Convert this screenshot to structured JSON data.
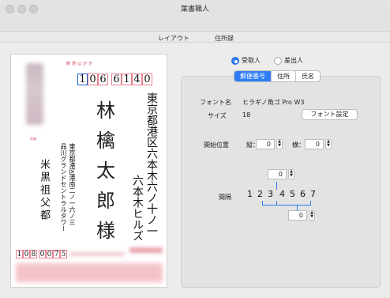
{
  "window": {
    "title": "葉書職人"
  },
  "toolbar": {
    "layout_label": "レイアウト",
    "address_book_label": "住所録"
  },
  "postcard": {
    "header_label": "郵便はがき",
    "recipient_postcode": [
      "1",
      "0",
      "6",
      "6",
      "1",
      "4",
      "0"
    ],
    "recipient_address_line1": "東京都港区六本木六ノ十ノ一",
    "recipient_address_line2": "六本木ヒルズ",
    "recipient_name_chars": [
      "林",
      "檎",
      "太",
      "郎",
      "様"
    ],
    "sender_address_line1": "東京都港区港南二ノ一六ノ三",
    "sender_address_line2": "品川グランドセントラルタワー",
    "sender_name": "米黒祖父都",
    "sender_postcode": [
      "1",
      "0",
      "8",
      "0",
      "0",
      "7",
      "5"
    ],
    "sender_label_small": "年賀"
  },
  "right": {
    "radio_recipient": "受取人",
    "radio_sender": "差出人",
    "tabs": [
      "郵便番号",
      "住所",
      "氏名"
    ],
    "font_name_label": "フォント名",
    "font_name_value": "ヒラギノ角ゴ Pro W3",
    "size_label": "サイズ",
    "size_value": "18",
    "font_settings_button": "フォント設定",
    "start_position_label": "開始位置",
    "vertical_label": "縦：",
    "vertical_value": "0",
    "horizontal_label": "横：",
    "horizontal_value": "0",
    "spacing_label": "間隔",
    "spacing_top_value": "0",
    "spacing_bottom_value": "0",
    "spacing_digits": [
      "1",
      "2",
      "3",
      "4",
      "5",
      "6",
      "7"
    ]
  },
  "colors": {
    "accent": "#2f7df6",
    "postcard_red": "#d6465a"
  }
}
